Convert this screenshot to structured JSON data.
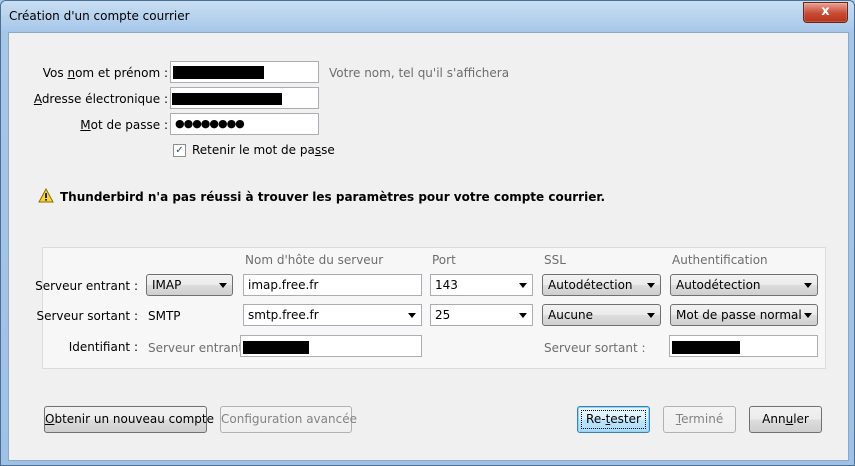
{
  "window": {
    "title": "Création d'un compte courrier",
    "close_label": "x"
  },
  "form": {
    "name_label_pre": "Vos ",
    "name_label_u": "n",
    "name_label_post": "om et prénom :",
    "name_hint": "Votre nom, tel qu'il s'affichera",
    "email_label_u": "A",
    "email_label_post": "dresse électronique :",
    "password_label_u": "M",
    "password_label_post": "ot de passe :",
    "password_value": "●●●●●●●●",
    "remember_pre": "Retenir le mot de pa",
    "remember_u": "s",
    "remember_post": "se",
    "remember_checked": "✓"
  },
  "warning": {
    "text": "Thunderbird n'a pas réussi à trouver les paramètres pour votre compte courrier."
  },
  "server": {
    "headers": {
      "hostname": "Nom d'hôte du serveur",
      "port": "Port",
      "ssl": "SSL",
      "auth": "Authentification"
    },
    "incoming": {
      "label": "Serveur entrant :",
      "protocol": "IMAP",
      "hostname": "imap.free.fr",
      "port": "143",
      "ssl": "Autodétection",
      "auth": "Autodétection"
    },
    "outgoing": {
      "label": "Serveur sortant :",
      "protocol": "SMTP",
      "hostname": "smtp.free.fr",
      "port": "25",
      "ssl": "Aucune",
      "auth": "Mot de passe normal"
    },
    "identifier": {
      "label": "Identifiant :",
      "incoming_label": "Serveur entrant :",
      "outgoing_label": "Serveur sortant :"
    }
  },
  "buttons": {
    "new_account_u": "O",
    "new_account_post": "btenir un nouveau compte",
    "advanced": "Configuration avancée",
    "retest_pre": "Re-",
    "retest_u": "t",
    "retest_post": "ester",
    "done_u": "T",
    "done_post": "erminé",
    "cancel_pre": "Ann",
    "cancel_u": "u",
    "cancel_post": "ler"
  }
}
